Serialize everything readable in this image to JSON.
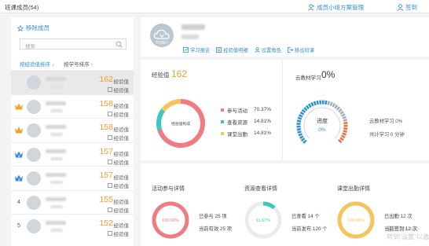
{
  "header": {
    "title": "班课成员(54)",
    "group_manage": "成员小组方案管理",
    "sign_in": "签到"
  },
  "left": {
    "remove_label": "移除成员",
    "search_placeholder": "搜索",
    "sort_exp": "按经验值排序 ↓",
    "sort_id": "按学号排序 ↑",
    "members": [
      {
        "rank": "",
        "score": "162",
        "unit": "经验值",
        "crown": "",
        "selected": true
      },
      {
        "rank": "",
        "score": "158",
        "unit": "经验值",
        "crown": "#f3a42b",
        "selected": false
      },
      {
        "rank": "",
        "score": "158",
        "unit": "经验值",
        "crown": "#f3a42b",
        "selected": false
      },
      {
        "rank": "3",
        "score": "157",
        "unit": "经验值",
        "crown": "#3a8ad6",
        "selected": false
      },
      {
        "rank": "3",
        "score": "157",
        "unit": "经验值",
        "crown": "#3a8ad6",
        "selected": false
      },
      {
        "rank": "4",
        "score": "155",
        "unit": "经验值",
        "crown": "",
        "selected": false
      },
      {
        "rank": "5",
        "score": "152",
        "unit": "经验值",
        "crown": "",
        "selected": false
      }
    ]
  },
  "profile": {
    "avatar_text": "学员图片",
    "links": [
      "学习报告",
      "经验值明细",
      "设置角色",
      "移出班课"
    ]
  },
  "experience": {
    "title": "经验值",
    "value": "162",
    "center": "经验值构成",
    "items": [
      {
        "label": "参与活动",
        "pct": "70.37%",
        "fraction": 0.7037,
        "color": "#f07b82"
      },
      {
        "label": "查看资源",
        "pct": "14.81%",
        "fraction": 0.1481,
        "color": "#3cc6c0"
      },
      {
        "label": "课堂出勤",
        "pct": "14.81%",
        "fraction": 0.1481,
        "color": "#f5c45a"
      }
    ]
  },
  "cloud": {
    "title": "云教材学习",
    "value": "0%",
    "gauge_label": "进度",
    "gauge_value": "0%",
    "info1": "云教材学习 0%",
    "info2": "共计学习 0 分钟"
  },
  "details": [
    {
      "title": "活动参与详情",
      "ring": "100.00%",
      "fraction": 1.0,
      "color": "#f07b82",
      "line1": "已参与 25 项",
      "line2": "当前有效 25 项"
    },
    {
      "title": "资源查看详情",
      "ring": "11.67%",
      "fraction": 0.1167,
      "color": "#3cc6c0",
      "line1": "已查看 14 个",
      "line2": "当前发布 120 个"
    },
    {
      "title": "课堂出勤详情",
      "ring": "100.00%",
      "fraction": 1.0,
      "color": "#f5c45a",
      "line1": "已出勤 12 次",
      "line2": "当前签到 12 次"
    }
  ],
  "watermark": {
    "line1": "激活 Windo",
    "line2": "转到\"设置\"以激"
  }
}
